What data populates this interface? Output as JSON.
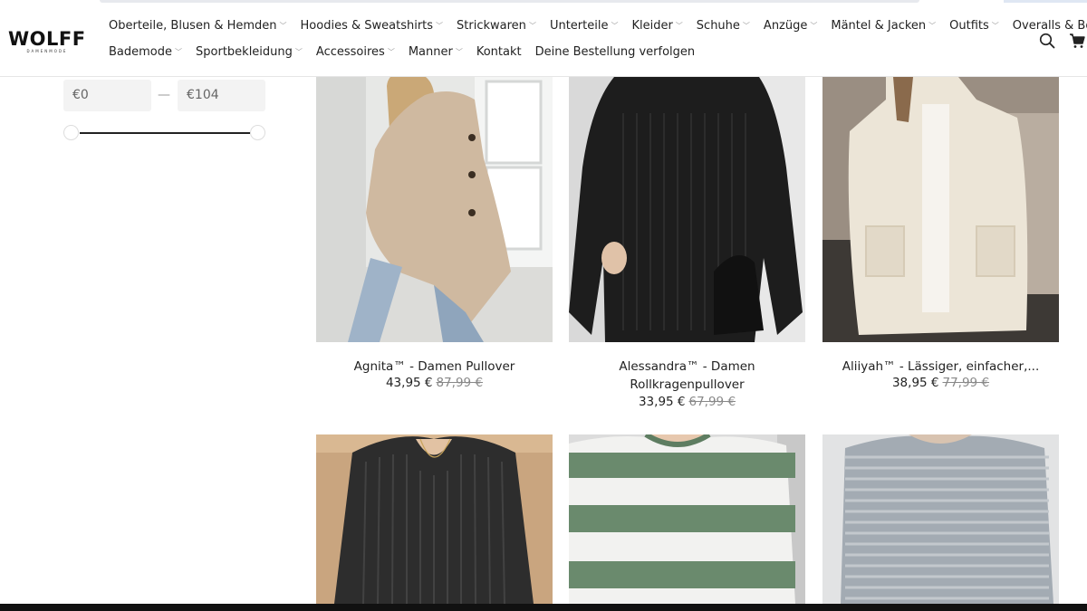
{
  "brand": {
    "name": "WOLFF",
    "tagline": "DAMENMODE"
  },
  "nav": {
    "row1": [
      {
        "label": "Oberteile, Blusen & Hemden",
        "dropdown": true
      },
      {
        "label": "Hoodies & Sweatshirts",
        "dropdown": true
      },
      {
        "label": "Strickwaren",
        "dropdown": true
      },
      {
        "label": "Unterteile",
        "dropdown": true
      },
      {
        "label": "Kleider",
        "dropdown": true
      },
      {
        "label": "Schuhe",
        "dropdown": true
      },
      {
        "label": "Anzüge",
        "dropdown": true
      },
      {
        "label": "Mäntel & Jacken",
        "dropdown": true
      },
      {
        "label": "Outfits",
        "dropdown": true
      },
      {
        "label": "Overalls & Bodys",
        "dropdown": true
      }
    ],
    "row2": [
      {
        "label": "Bademode",
        "dropdown": true
      },
      {
        "label": "Sportbekleidung",
        "dropdown": true
      },
      {
        "label": "Accessoires",
        "dropdown": true
      },
      {
        "label": "Manner",
        "dropdown": true
      },
      {
        "label": "Kontakt",
        "dropdown": false
      },
      {
        "label": "Deine Bestellung verfolgen",
        "dropdown": false
      }
    ]
  },
  "header_icons": [
    "search-icon",
    "cart-icon"
  ],
  "filter": {
    "price_min": "€0",
    "price_max": "€104",
    "separator": "—"
  },
  "products": [
    {
      "title": "Agnita™ - Damen Pullover",
      "title_line2": "",
      "price": "43,95 €",
      "old_price": "87,99 €"
    },
    {
      "title": "Alessandra™ - Damen",
      "title_line2": "Rollkragenpullover",
      "price": "33,95 €",
      "old_price": "67,99 €"
    },
    {
      "title": "Aliiyah™ - Lässiger, einfacher,...",
      "title_line2": "",
      "price": "38,95 €",
      "old_price": "77,99 €"
    },
    {
      "title": "",
      "title_line2": "",
      "price": "",
      "old_price": ""
    },
    {
      "title": "",
      "title_line2": "",
      "price": "",
      "old_price": ""
    },
    {
      "title": "",
      "title_line2": "",
      "price": "",
      "old_price": ""
    }
  ],
  "colors": {
    "accent": "#222222",
    "old_price": "#888888",
    "filter_bg": "#f3f3f3"
  }
}
